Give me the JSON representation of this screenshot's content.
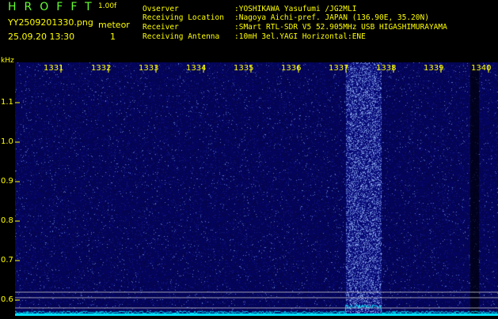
{
  "header": {
    "title": "HROFFT",
    "version": "1.00f",
    "filename": "YY2509201330.png",
    "datetime": "25.09.20 13:30",
    "mode_label": "meteor",
    "mode_count": "1"
  },
  "info": [
    {
      "label": "Ovserver",
      "value": ":YOSHIKAWA Yasufumi /JG2MLI"
    },
    {
      "label": "Receiving Location",
      "value": ":Nagoya Aichi-pref. JAPAN (136.90E, 35.20N)"
    },
    {
      "label": "Receiver",
      "value": ":SMart RTL-SDR V5 52.905MHz USB HIGASHIMURAYAMA"
    },
    {
      "label": "Receiving Antenna",
      "value": ":10mH 3el.YAGI Horizontal:ENE"
    }
  ],
  "axis": {
    "unit": "kHz",
    "x_ticks": [
      "1331",
      "1332",
      "1333",
      "1334",
      "1335",
      "1336",
      "1337",
      "1338",
      "1339",
      "1340"
    ],
    "y_ticks": [
      "1.1",
      "1.0",
      "0.9",
      "0.8",
      "0.7",
      "0.6"
    ]
  },
  "colors": {
    "background": "#000000",
    "plot": "#04045a",
    "text": "#ffff00",
    "title": "#66ff33",
    "signal": "#8fb4ff",
    "spectrum": "#00e5ff"
  }
}
